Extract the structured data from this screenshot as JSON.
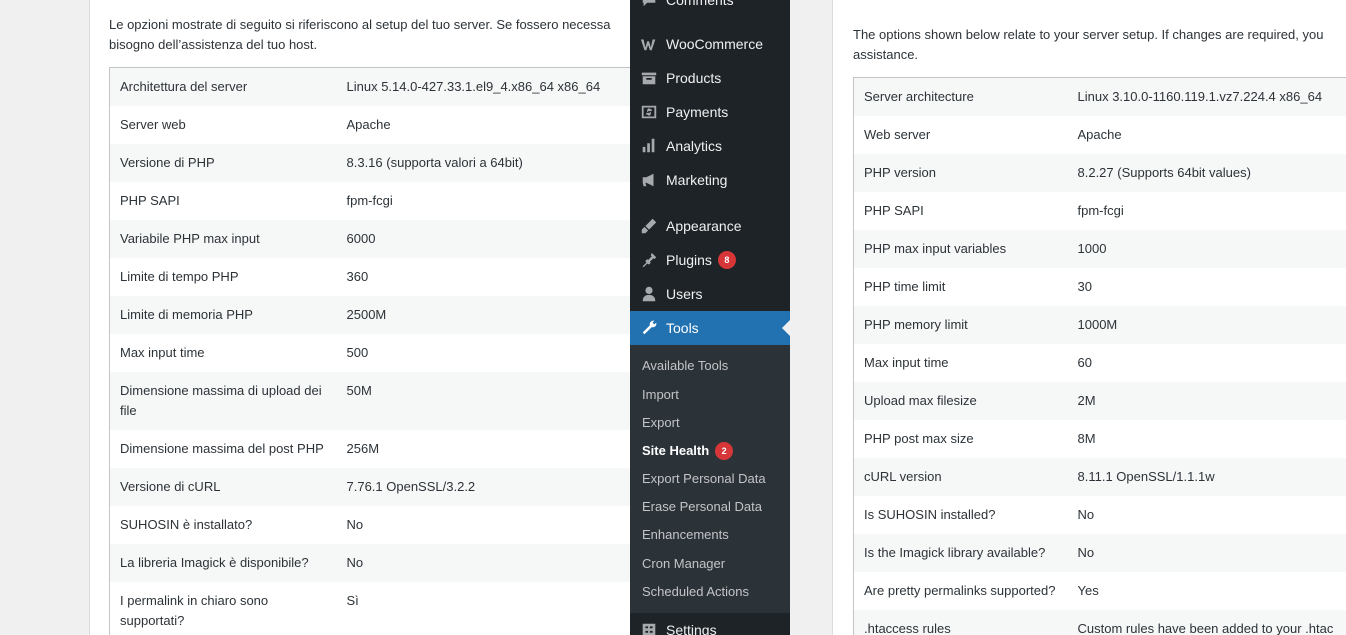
{
  "left_panel": {
    "intro": "Le opzioni mostrate di seguito si riferiscono al setup del tuo server. Se fossero necessa bisogno dell’assistenza del tuo host.",
    "intro_line1": "Le opzioni mostrate di seguito si riferiscono al setup del tuo server. Se fossero necessa",
    "intro_line2": "bisogno dell’assistenza del tuo host.",
    "rows": [
      {
        "label": "Architettura del server",
        "value": "Linux 5.14.0-427.33.1.el9_4.x86_64 x86_64"
      },
      {
        "label": "Server web",
        "value": "Apache"
      },
      {
        "label": "Versione di PHP",
        "value": "8.3.16 (supporta valori a 64bit)"
      },
      {
        "label": "PHP SAPI",
        "value": "fpm-fcgi"
      },
      {
        "label": "Variabile PHP max input",
        "value": "6000"
      },
      {
        "label": "Limite di tempo PHP",
        "value": "360"
      },
      {
        "label": "Limite di memoria PHP",
        "value": "2500M"
      },
      {
        "label": "Max input time",
        "value": "500"
      },
      {
        "label": "Dimensione massima di upload dei file",
        "value": "50M"
      },
      {
        "label": "Dimensione massima del post PHP",
        "value": "256M"
      },
      {
        "label": "Versione di cURL",
        "value": "7.76.1 OpenSSL/3.2.2"
      },
      {
        "label": "SUHOSIN è installato?",
        "value": "No"
      },
      {
        "label": "La libreria Imagick è disponibile?",
        "value": "No"
      },
      {
        "label": "I permalink in chiaro sono supportati?",
        "value": "Sì"
      }
    ]
  },
  "menu": {
    "items": [
      {
        "label": "Comments",
        "icon": "comments-icon"
      },
      {
        "label": "WooCommerce",
        "icon": "woocommerce-icon"
      },
      {
        "label": "Products",
        "icon": "products-icon"
      },
      {
        "label": "Payments",
        "icon": "payments-icon"
      },
      {
        "label": "Analytics",
        "icon": "analytics-icon"
      },
      {
        "label": "Marketing",
        "icon": "marketing-icon"
      },
      {
        "label": "Appearance",
        "icon": "appearance-icon"
      },
      {
        "label": "Plugins",
        "icon": "plugins-icon",
        "badge": "8"
      },
      {
        "label": "Users",
        "icon": "users-icon"
      },
      {
        "label": "Tools",
        "icon": "tools-icon"
      },
      {
        "label": "Settings",
        "icon": "settings-icon"
      }
    ],
    "submenu": [
      {
        "label": "Available Tools"
      },
      {
        "label": "Import"
      },
      {
        "label": "Export"
      },
      {
        "label": "Site Health",
        "badge": "2"
      },
      {
        "label": "Export Personal Data"
      },
      {
        "label": "Erase Personal Data"
      },
      {
        "label": "Enhancements"
      },
      {
        "label": "Cron Manager"
      },
      {
        "label": "Scheduled Actions"
      }
    ],
    "colors": {
      "background": "#1d2327",
      "active": "#2271b1",
      "submenu": "#2c3338",
      "badge": "#d63638"
    }
  },
  "right_panel": {
    "intro_line1": "The options shown below relate to your server setup. If changes are required, you",
    "intro_line2": "assistance.",
    "rows": [
      {
        "label": "Server architecture",
        "value": "Linux 3.10.0-1160.119.1.vz7.224.4 x86_64"
      },
      {
        "label": "Web server",
        "value": "Apache"
      },
      {
        "label": "PHP version",
        "value": "8.2.27 (Supports 64bit values)"
      },
      {
        "label": "PHP SAPI",
        "value": "fpm-fcgi"
      },
      {
        "label": "PHP max input variables",
        "value": "1000"
      },
      {
        "label": "PHP time limit",
        "value": "30"
      },
      {
        "label": "PHP memory limit",
        "value": "1000M"
      },
      {
        "label": "Max input time",
        "value": "60"
      },
      {
        "label": "Upload max filesize",
        "value": "2M"
      },
      {
        "label": "PHP post max size",
        "value": "8M"
      },
      {
        "label": "cURL version",
        "value": "8.11.1 OpenSSL/1.1.1w"
      },
      {
        "label": "Is SUHOSIN installed?",
        "value": "No"
      },
      {
        "label": "Is the Imagick library available?",
        "value": "No"
      },
      {
        "label": "Are pretty permalinks supported?",
        "value": "Yes"
      },
      {
        "label": ".htaccess rules",
        "value": "Custom rules have been added to your .htac"
      }
    ]
  }
}
